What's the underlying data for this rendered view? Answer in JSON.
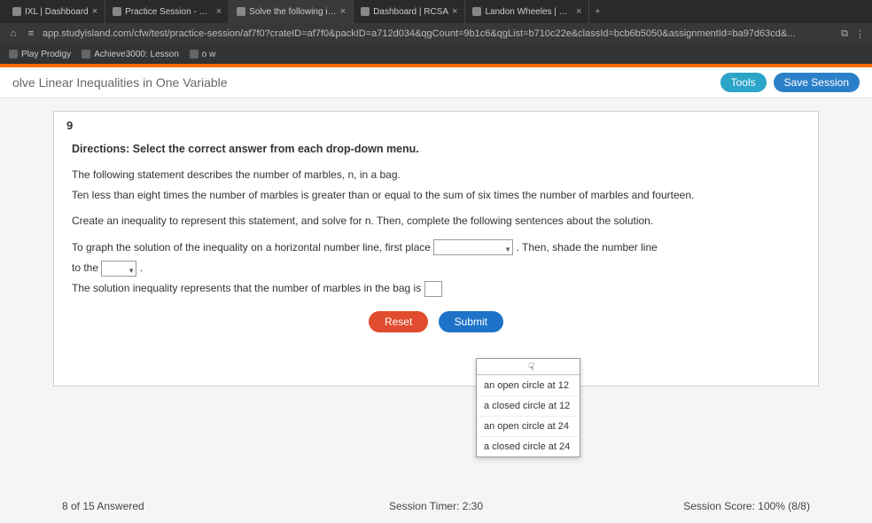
{
  "browser": {
    "tabs": [
      {
        "label": "IXL | Dashboard"
      },
      {
        "label": "Practice Session - Solve L"
      },
      {
        "label": "Solve the following inequa"
      },
      {
        "label": "Dashboard | RCSA"
      },
      {
        "label": "Landon Wheeles | RCSA"
      }
    ],
    "add_label": "+",
    "url": "app.studyisland.com/cfw/test/practice-session/af7f0?crateID=af7f0&packID=a712d034&qgCount=9b1c6&qgList=b710c22e&classId=bcb6b5050&assignmentId=ba97d63cd&...",
    "bookmarks": [
      {
        "label": "Play Prodigy"
      },
      {
        "label": "Achieve3000: Lesson"
      },
      {
        "label": "o w"
      }
    ],
    "menu_icon": "⋮",
    "copy_icon": "⧉"
  },
  "header": {
    "title": "olve Linear Inequalities in One Variable",
    "tools_label": "Tools",
    "save_label": "Save Session"
  },
  "question": {
    "number": "9",
    "directions": "Directions: Select the correct answer from each drop-down menu.",
    "line1": "The following statement describes the number of marbles, n, in a bag.",
    "line2": "Ten less than eight times the number of marbles is greater than or equal to the sum of six times the number of marbles and fourteen.",
    "line3": "Create an inequality to represent this statement, and solve for n.  Then, complete the following sentences about the solution.",
    "graph_pre": "To graph the solution of the inequality on a horizontal number line, first place ",
    "graph_post": " .  Then, shade the number line",
    "to_the": "to the ",
    "sol_pre": "The solution inequality represents that the number of marbles in the bag is ",
    "dropdown_options": [
      "an open circle at 12",
      "a closed circle at 12",
      "an open circle at 24",
      "a closed circle at 24"
    ],
    "reset_label": "Reset",
    "submit_label": "Submit"
  },
  "footer": {
    "answered": "8 of 15 Answered",
    "timer": "Session Timer: 2:30",
    "score": "Session Score: 100% (8/8)"
  }
}
